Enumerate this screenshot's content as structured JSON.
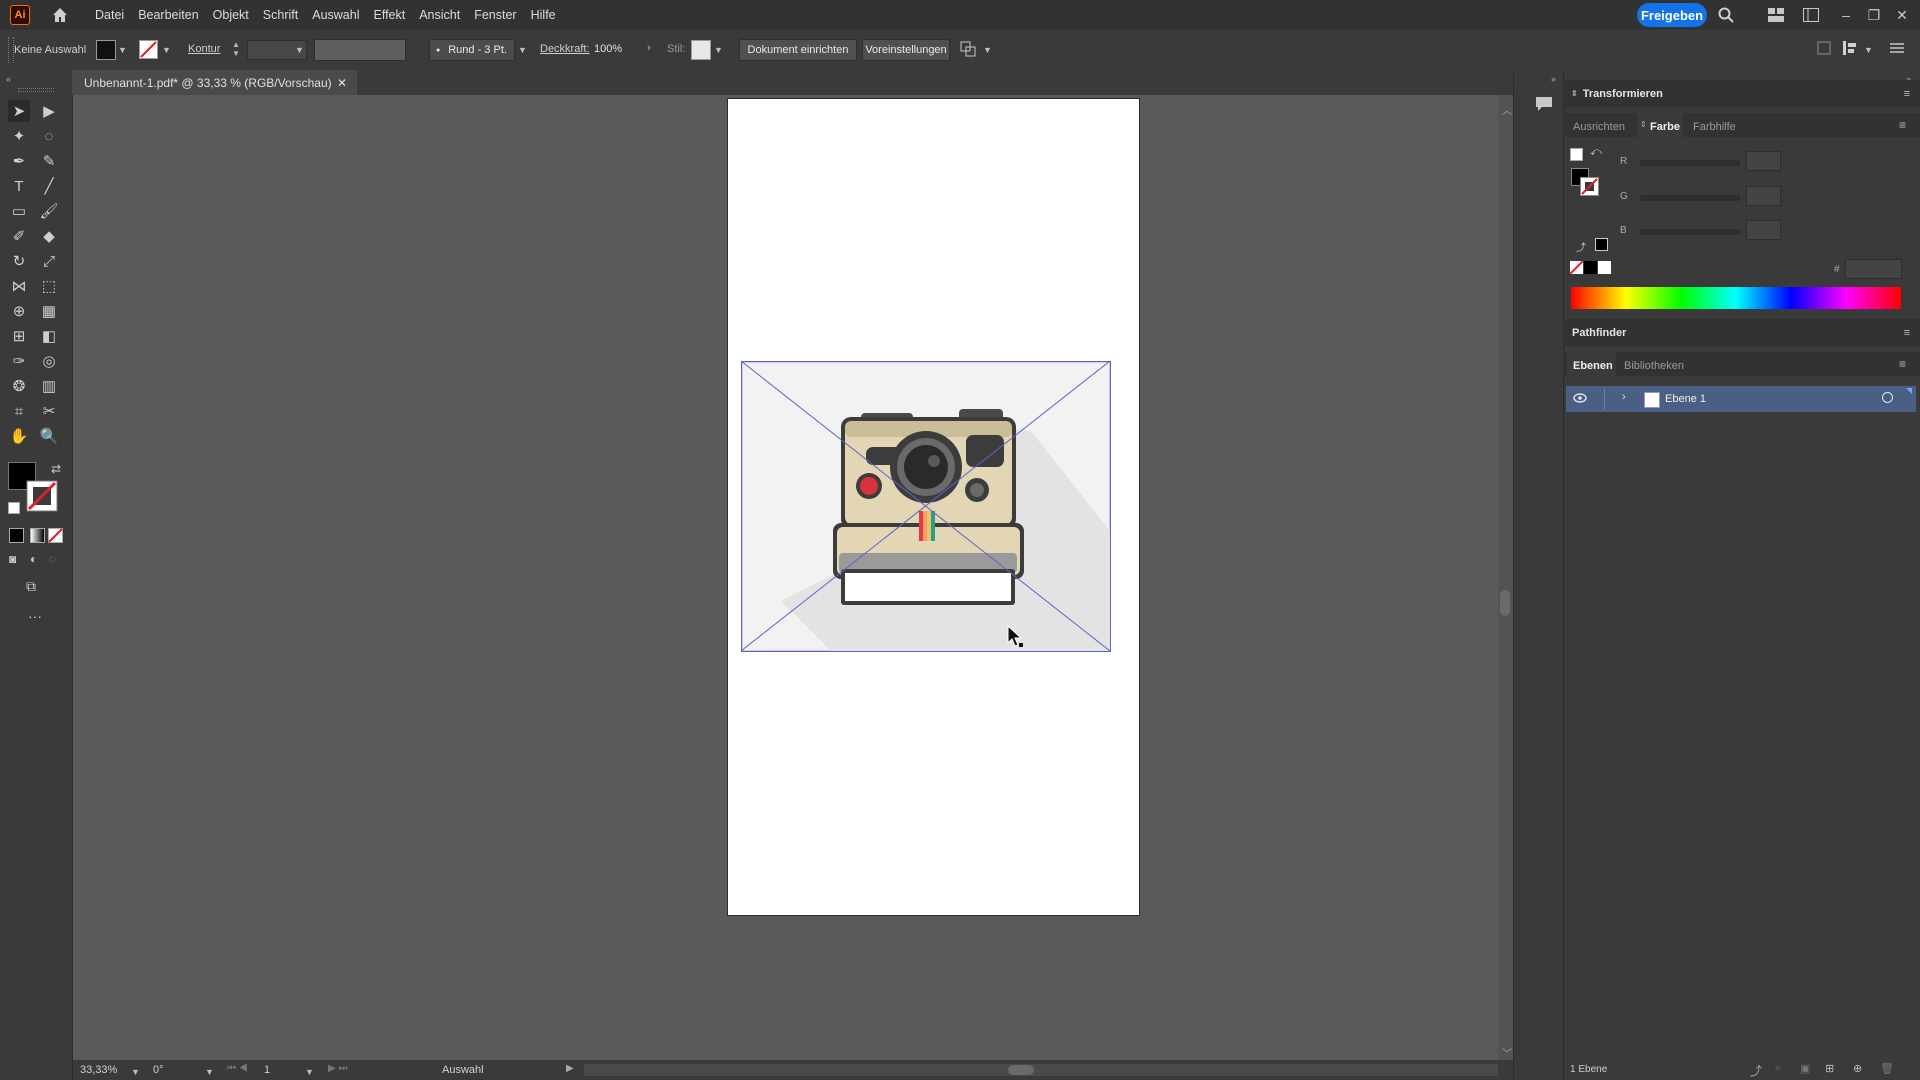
{
  "app": {
    "logo": "Ai",
    "menus": [
      "Datei",
      "Bearbeiten",
      "Objekt",
      "Schrift",
      "Auswahl",
      "Effekt",
      "Ansicht",
      "Fenster",
      "Hilfe"
    ],
    "share_label": "Freigeben"
  },
  "control": {
    "selection": "Keine Auswahl",
    "stroke_label": "Kontur",
    "brush": "Rund - 3 Pt.",
    "opacity_label": "Deckkraft:",
    "opacity_value": "100%",
    "style_label": "Stil:",
    "doc_setup": "Dokument einrichten",
    "preferences": "Voreinstellungen"
  },
  "document": {
    "tab_title": "Unbenannt-1.pdf* @ 33,33 % (RGB/Vorschau)"
  },
  "status": {
    "zoom": "33,33%",
    "rotation": "0°",
    "artboard": "1",
    "tool": "Auswahl",
    "layer_count": "1 Ebene"
  },
  "panels": {
    "transform_title": "Transformieren",
    "color_tabs": [
      "Ausrichten",
      "Farbe",
      "Farbhilfe"
    ],
    "channels": [
      "R",
      "G",
      "B"
    ],
    "hex_prefix": "#",
    "pathfinder_title": "Pathfinder",
    "layer_tabs": [
      "Ebenen",
      "Bibliotheken"
    ],
    "layer_name": "Ebene 1"
  },
  "colors": {
    "accent": "#1473e6",
    "selected_layer": "#4a5f86",
    "frame_line": "#5b63c9"
  }
}
